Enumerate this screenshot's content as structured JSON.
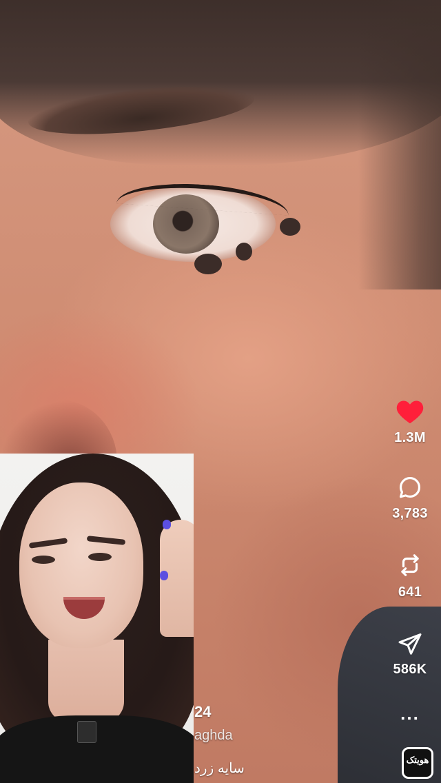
{
  "actions": {
    "like": {
      "count": "1.3M",
      "icon": "heart-icon",
      "color": "#ff1f3a"
    },
    "comment": {
      "count": "3,783",
      "icon": "comment-bubble-icon"
    },
    "repost": {
      "count": "641",
      "icon": "repost-icon"
    },
    "share": {
      "count": "586K",
      "icon": "send-icon"
    },
    "more": "...",
    "audio_label": "هویتک"
  },
  "caption": {
    "user_fragment": "24",
    "handle_fragment": "aghda",
    "text_fragment": "سایه زرد"
  }
}
